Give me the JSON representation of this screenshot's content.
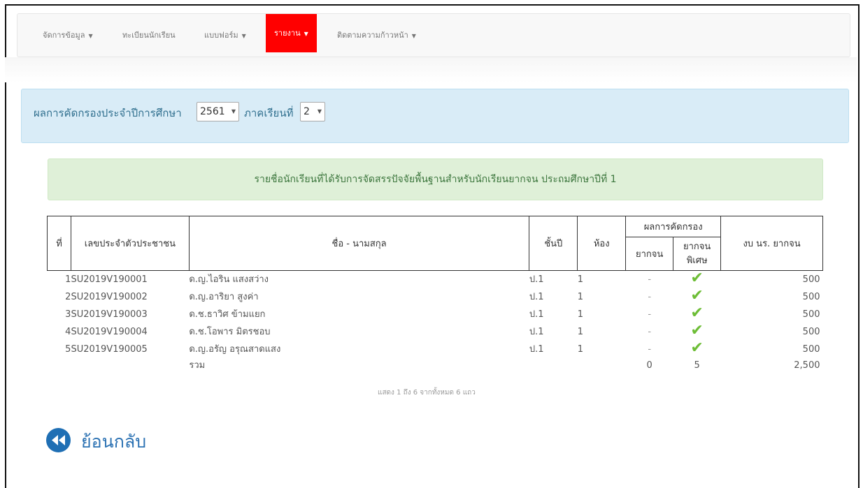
{
  "nav": {
    "items": [
      {
        "label": "จัดการข้อมูล",
        "dropdown": true
      },
      {
        "label": "ทะเบียนนักเรียน",
        "dropdown": false
      },
      {
        "label": "แบบฟอร์ม",
        "dropdown": true
      },
      {
        "label": "รายงาน",
        "dropdown": true,
        "active": true
      },
      {
        "label": "ติดตามความก้าวหน้า",
        "dropdown": true
      }
    ],
    "active_color": "#ff0000"
  },
  "filter": {
    "prefix": "ผลการคัดกรองประจำปีการศึกษา",
    "year_value": "2561",
    "term_label": "ภาคเรียนที่",
    "term_value": "2"
  },
  "report": {
    "title": "รายชื่อนักเรียนที่ได้รับการจัดสรรปัจจัยพื้นฐานสำหรับนักเรียนยากจน ประถมศึกษาปีที่ 1",
    "headers": {
      "no": "ที่",
      "citizen_id": "เลขประจำตัวประชาชน",
      "name": "ชื่อ - นามสกุล",
      "grade": "ชั้นปี",
      "room": "ห้อง",
      "screening": "ผลการคัดกรอง",
      "poor": "ยากจน",
      "very_poor": "ยากจนพิเศษ",
      "budget": "งบ นร. ยากจน"
    },
    "rows": [
      {
        "no": "1",
        "id": "SU2019V190001",
        "name": "ด.ญ.ไอริน แสงสว่าง",
        "grade": "ป.1",
        "room": "1",
        "poor": "-",
        "very_poor": "check-icon",
        "budget": "500"
      },
      {
        "no": "2",
        "id": "SU2019V190002",
        "name": "ด.ญ.อาริยา สูงค่า",
        "grade": "ป.1",
        "room": "1",
        "poor": "-",
        "very_poor": "check-icon",
        "budget": "500"
      },
      {
        "no": "3",
        "id": "SU2019V190003",
        "name": "ด.ช.ธาวิศ ข้ามแยก",
        "grade": "ป.1",
        "room": "1",
        "poor": "-",
        "very_poor": "check-icon",
        "budget": "500"
      },
      {
        "no": "4",
        "id": "SU2019V190004",
        "name": "ด.ช.โอพาร มิตรชอบ",
        "grade": "ป.1",
        "room": "1",
        "poor": "-",
        "very_poor": "check-icon",
        "budget": "500"
      },
      {
        "no": "5",
        "id": "SU2019V190005",
        "name": "ด.ญ.อรัญ อรุณสาดแสง",
        "grade": "ป.1",
        "room": "1",
        "poor": "-",
        "very_poor": "check-icon",
        "budget": "500"
      }
    ],
    "total": {
      "label": "รวม",
      "poor": "0",
      "very_poor": "5",
      "budget": "2,500"
    },
    "paging": "แสดง 1 ถึง 6 จากทั้งหมด 6 แถว"
  },
  "back": {
    "label": "ย้อนกลับ",
    "icon": "rewind-icon"
  }
}
